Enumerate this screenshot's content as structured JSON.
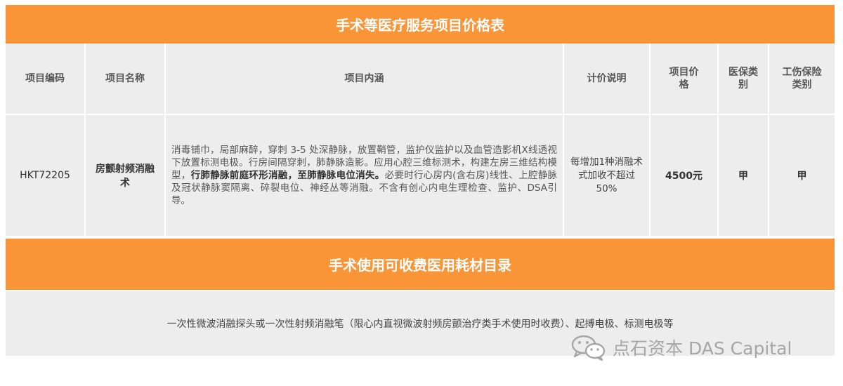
{
  "pricing": {
    "title": "手术等医疗服务项目价格表",
    "headers": {
      "code": "项目编码",
      "name": "项目名称",
      "content": "项目内涵",
      "billing": "计价说明",
      "price": "项目价格",
      "insurance": "医保类别",
      "injury": "工伤保险类别"
    },
    "row": {
      "code": "HKT72205",
      "name": "房颤射频消融术",
      "content_part1": "消毒铺巾，局部麻醉，穿刺 3-5 处深静脉，放置鞘管，监护仪监护以及血管造影机X线透视下放置标测电极。行房间隔穿刺，肺静脉造影。应用心腔三维标测术，构建左房三维结构模型，",
      "content_bold": "行肺静脉前庭环形消融，至肺静脉电位消失。",
      "content_part2": "必要时行心房内(含右房)线性、上腔静脉及冠状静脉窦隔离、碎裂电位、神经丛等消融。不含有创心内电生理检查、监护、DSA引导。",
      "billing": "每增加1种消融术式加收不超过50%",
      "price": "4500元",
      "insurance": "甲",
      "injury": "甲"
    }
  },
  "consumables": {
    "title": "手术使用可收费医用耗材目录",
    "text": "一次性微波消融探头或一次性射频消融笔（限心内直视微波射频房颤治疗类手术使用时收费）、起搏电极、标测电极等"
  },
  "watermark": {
    "icon": "wechat-icon",
    "text": "点石资本 DAS Capital"
  }
}
